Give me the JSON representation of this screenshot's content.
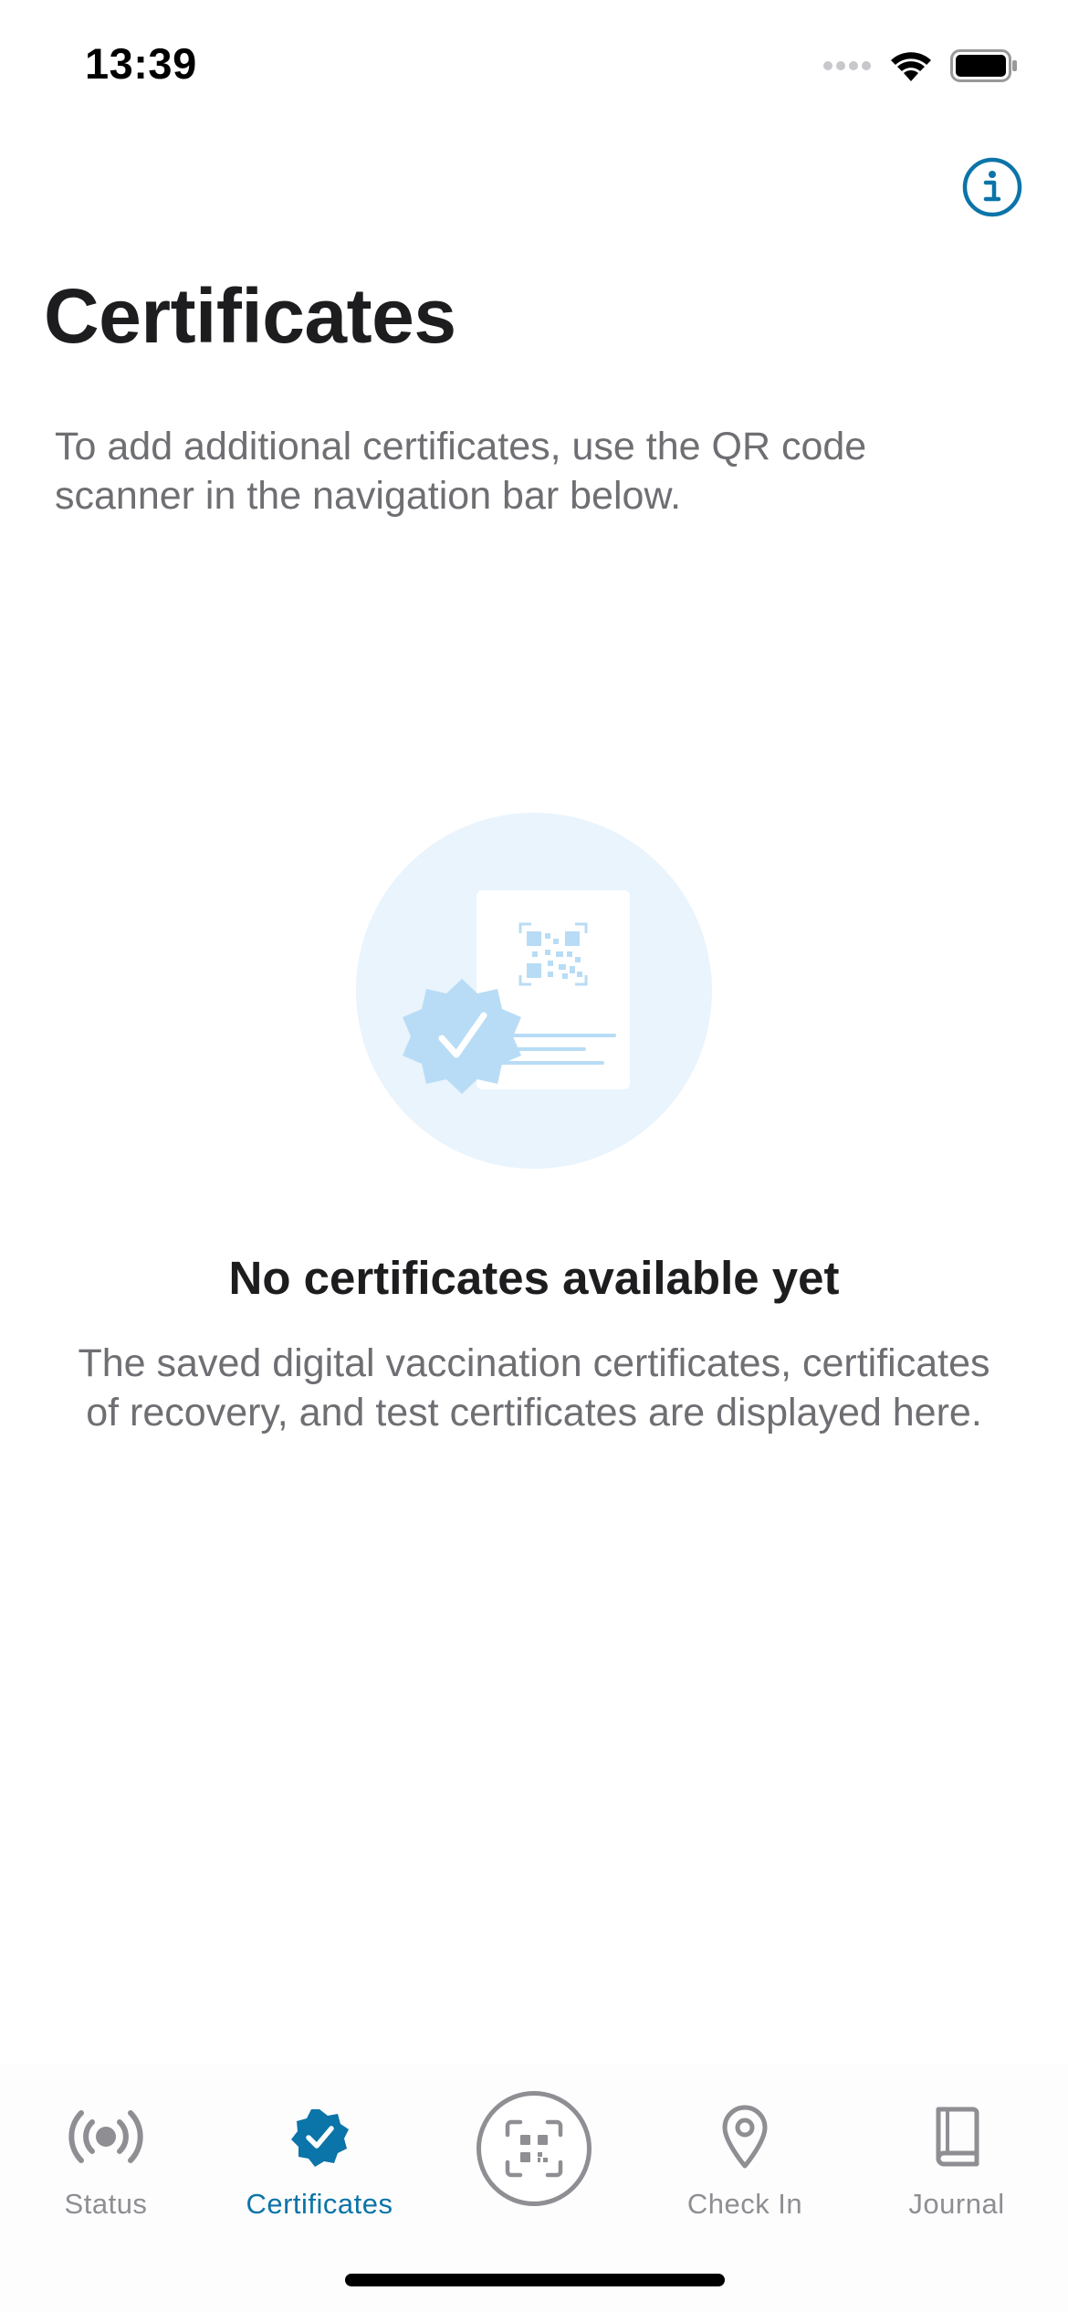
{
  "status_bar": {
    "time": "13:39"
  },
  "header": {
    "title": "Certificates",
    "subtitle": "To add additional certificates, use the QR code scanner in the navigation bar below.",
    "info_icon": "info-circle-icon"
  },
  "empty_state": {
    "illustration_icon": "certificate-qr-badge-illustration",
    "title": "No certificates available yet",
    "description": "The saved digital vaccination certificates, certificates of recovery, and test certificates are displayed here."
  },
  "tab_bar": {
    "items": [
      {
        "label": "Status",
        "icon": "radio-waves-icon",
        "active": false
      },
      {
        "label": "Certificates",
        "icon": "verified-badge-icon",
        "active": true
      },
      {
        "label": "",
        "icon": "qr-scanner-icon",
        "active": false
      },
      {
        "label": "Check In",
        "icon": "location-pin-icon",
        "active": false
      },
      {
        "label": "Journal",
        "icon": "book-icon",
        "active": false
      }
    ]
  },
  "colors": {
    "accent": "#0b74a8",
    "inactive": "#8e8e93",
    "illustration_bg": "#e9f4fd",
    "illustration_badge": "#b8dcf5"
  }
}
